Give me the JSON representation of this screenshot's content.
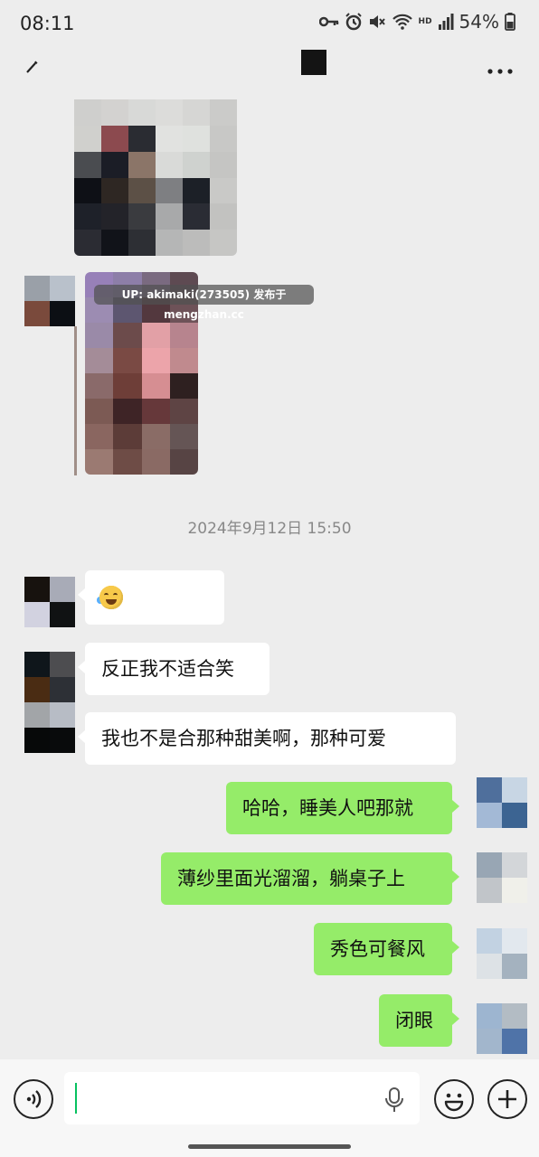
{
  "status_bar": {
    "time": "08:11",
    "battery": "54%",
    "network": "HD"
  },
  "watermark": "UP: akimaki(273505) 发布于 mengzhan.cc",
  "timestamp": "2024年9月12日 15:50",
  "messages": [
    {
      "side": "left",
      "type": "emoji",
      "text": ""
    },
    {
      "side": "left",
      "type": "text",
      "text": "反正我不适合笑"
    },
    {
      "side": "left",
      "type": "text",
      "text": "我也不是合那种甜美啊，那种可爱"
    },
    {
      "side": "right",
      "type": "text",
      "text": "哈哈，睡美人吧那就"
    },
    {
      "side": "right",
      "type": "text",
      "text": "薄纱里面光溜溜，躺桌子上"
    },
    {
      "side": "right",
      "type": "text",
      "text": "秀色可餐风"
    },
    {
      "side": "right",
      "type": "text",
      "text": "闭眼"
    }
  ],
  "input": {
    "value": "",
    "placeholder": ""
  },
  "icons": {
    "back": "pen-icon",
    "more": "more-dots-icon",
    "voice": "voice-icon",
    "mic": "mic-icon",
    "emoji": "emoji-icon",
    "plus": "plus-icon"
  },
  "colors": {
    "outgoing_bubble": "#95ec69",
    "incoming_bubble": "#ffffff",
    "background": "#ededed",
    "cursor": "#07c160"
  }
}
